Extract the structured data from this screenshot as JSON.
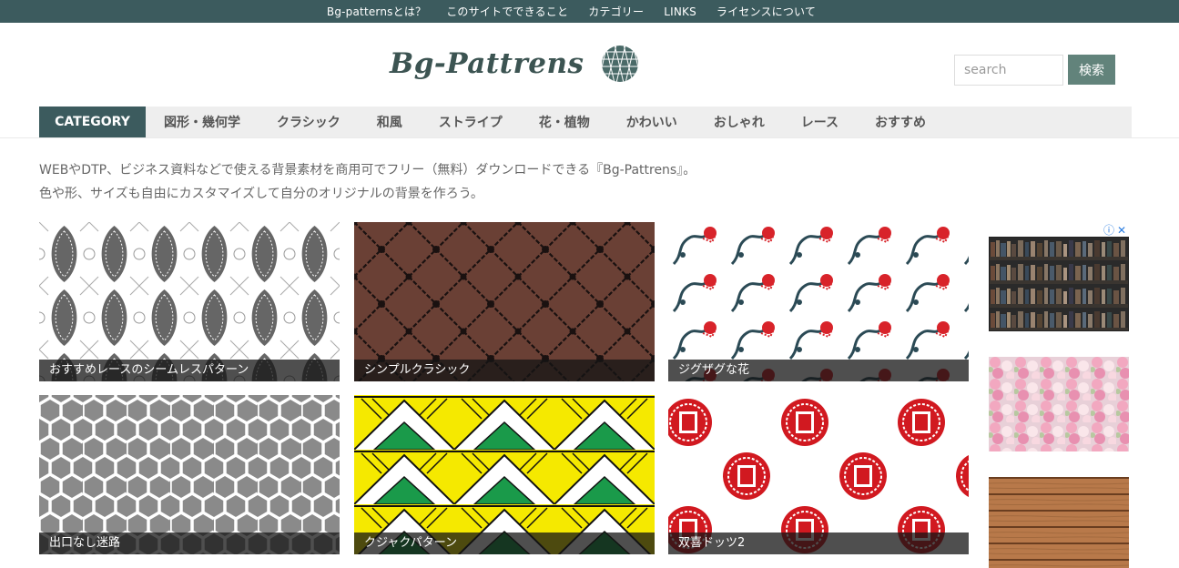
{
  "topnav": {
    "items": [
      "Bg-patternsとは？",
      "このサイトでできること",
      "カテゴリー",
      "LINKS",
      "ライセンスについて"
    ]
  },
  "header": {
    "logo_text": "Bg-Pattrens",
    "search_placeholder": "search",
    "search_button": "検索"
  },
  "category_nav": {
    "label": "CATEGORY",
    "items": [
      "図形・幾何学",
      "クラシック",
      "和風",
      "ストライプ",
      "花・植物",
      "かわいい",
      "おしゃれ",
      "レース",
      "おすすめ"
    ]
  },
  "intro": {
    "line1": "WEBやDTP、ビジネス資料などで使える背景素材を商用可でフリー（無料）ダウンロードできる『Bg-Pattrens』。",
    "line2": "色や形、サイズも自由にカスタマイズして自分のオリジナルの背景を作ろう。"
  },
  "patterns": [
    {
      "title": "おすすめレースのシームレスパターン",
      "icon": "lace-pattern"
    },
    {
      "title": "シンプルクラシック",
      "icon": "classic-damask-pattern"
    },
    {
      "title": "ジグザグな花",
      "icon": "zigzag-flower-pattern"
    },
    {
      "title": "出口なし迷路",
      "icon": "maze-pattern"
    },
    {
      "title": "クジャクパターン",
      "icon": "peacock-triangle-pattern"
    },
    {
      "title": "双喜ドッツ2",
      "icon": "double-happiness-dots-pattern"
    }
  ],
  "ads": {
    "images": [
      "bookshelf-photo",
      "flower-wall-photo",
      "wood-plank-photo"
    ]
  },
  "colors": {
    "topbar": "#3c5b5e",
    "accent": "#62837b",
    "category_bg": "#eeeeee"
  }
}
